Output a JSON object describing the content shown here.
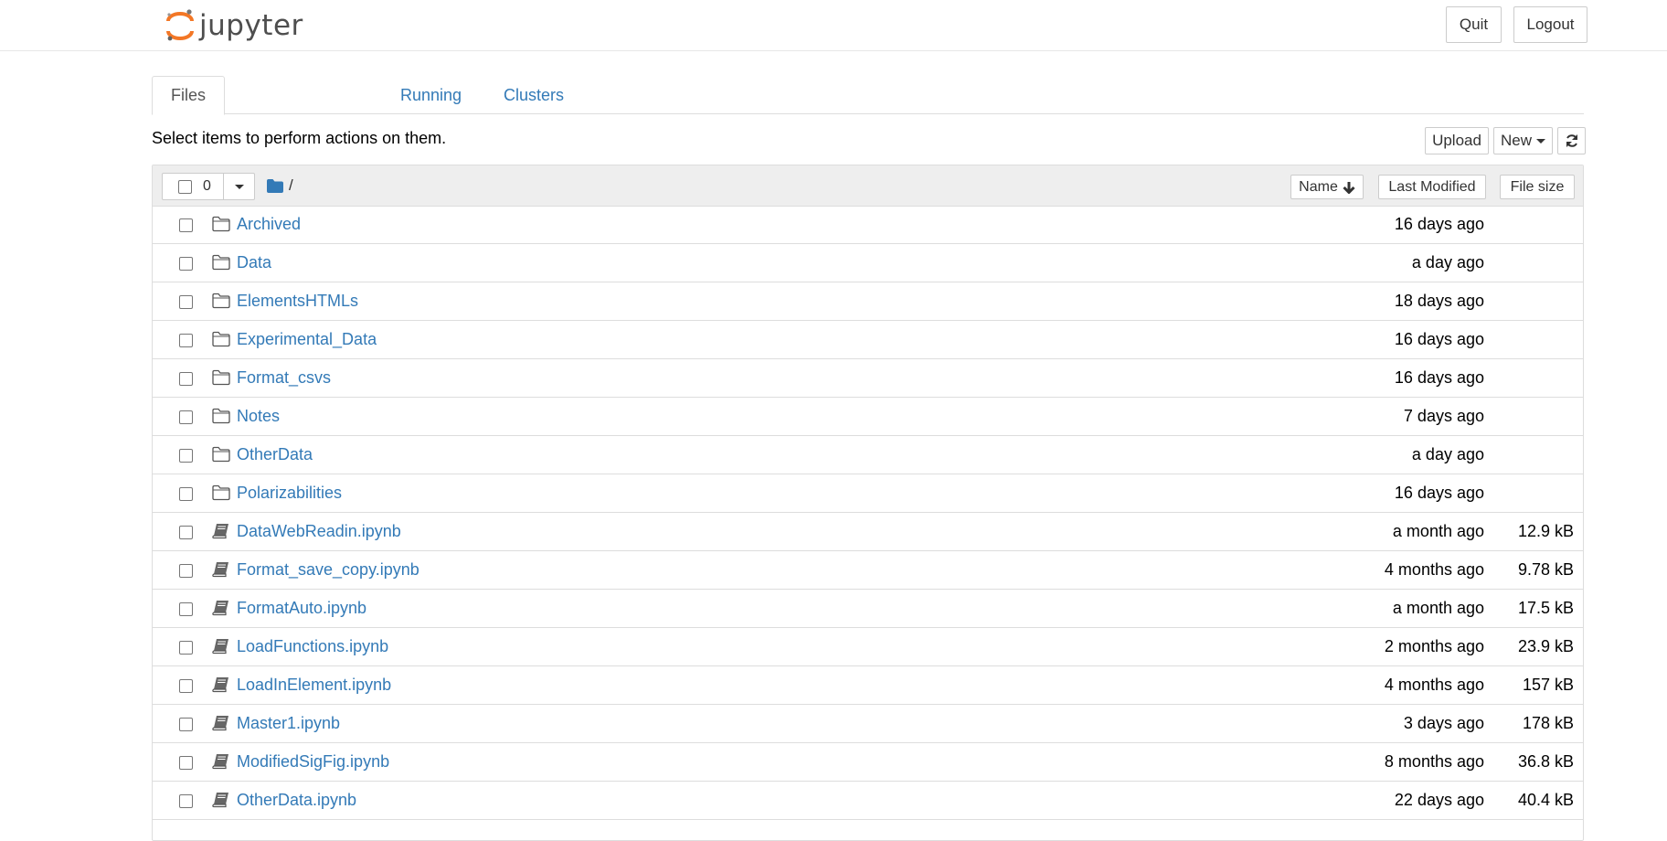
{
  "header": {
    "logo_text": "jupyter",
    "quit_label": "Quit",
    "logout_label": "Logout"
  },
  "tabs": [
    {
      "label": "Files",
      "active": true
    },
    {
      "label": "Running",
      "active": false
    },
    {
      "label": "Clusters",
      "active": false
    }
  ],
  "toolbar": {
    "instruction": "Select items to perform actions on them.",
    "upload_label": "Upload",
    "new_label": "New"
  },
  "list_header": {
    "selected_count": "0",
    "breadcrumb": "/",
    "sort_name_label": "Name",
    "sort_modified_label": "Last Modified",
    "sort_size_label": "File size"
  },
  "items": [
    {
      "name": "Archived",
      "type": "folder",
      "modified": "16 days ago",
      "size": ""
    },
    {
      "name": "Data",
      "type": "folder",
      "modified": "a day ago",
      "size": ""
    },
    {
      "name": "ElementsHTMLs",
      "type": "folder",
      "modified": "18 days ago",
      "size": ""
    },
    {
      "name": "Experimental_Data",
      "type": "folder",
      "modified": "16 days ago",
      "size": ""
    },
    {
      "name": "Format_csvs",
      "type": "folder",
      "modified": "16 days ago",
      "size": ""
    },
    {
      "name": "Notes",
      "type": "folder",
      "modified": "7 days ago",
      "size": ""
    },
    {
      "name": "OtherData",
      "type": "folder",
      "modified": "a day ago",
      "size": ""
    },
    {
      "name": "Polarizabilities",
      "type": "folder",
      "modified": "16 days ago",
      "size": ""
    },
    {
      "name": "DataWebReadin.ipynb",
      "type": "notebook",
      "modified": "a month ago",
      "size": "12.9 kB"
    },
    {
      "name": "Format_save_copy.ipynb",
      "type": "notebook",
      "modified": "4 months ago",
      "size": "9.78 kB"
    },
    {
      "name": "FormatAuto.ipynb",
      "type": "notebook",
      "modified": "a month ago",
      "size": "17.5 kB"
    },
    {
      "name": "LoadFunctions.ipynb",
      "type": "notebook",
      "modified": "2 months ago",
      "size": "23.9 kB"
    },
    {
      "name": "LoadInElement.ipynb",
      "type": "notebook",
      "modified": "4 months ago",
      "size": "157 kB"
    },
    {
      "name": "Master1.ipynb",
      "type": "notebook",
      "modified": "3 days ago",
      "size": "178 kB"
    },
    {
      "name": "ModifiedSigFig.ipynb",
      "type": "notebook",
      "modified": "8 months ago",
      "size": "36.8 kB"
    },
    {
      "name": "OtherData.ipynb",
      "type": "notebook",
      "modified": "22 days ago",
      "size": "40.4 kB"
    }
  ],
  "colors": {
    "link": "#337ab7",
    "logo_orange": "#f37726",
    "header_bg": "#eeeeee"
  }
}
